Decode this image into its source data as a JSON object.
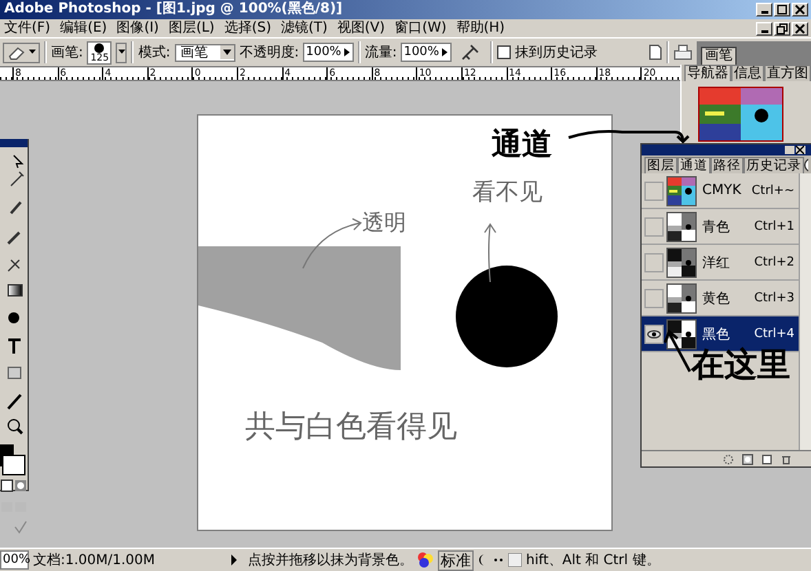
{
  "window": {
    "title": "Adobe Photoshop - [图1.jpg @ 100%(黑色/8)]"
  },
  "menu": [
    "文件(F)",
    "编辑(E)",
    "图像(I)",
    "图层(L)",
    "选择(S)",
    "滤镜(T)",
    "视图(V)",
    "窗口(W)",
    "帮助(H)"
  ],
  "options_bar": {
    "brush_label": "画笔:",
    "brush_size": "125",
    "mode_label": "模式:",
    "mode_value": "画笔",
    "opacity_label": "不透明度:",
    "opacity_value": "100%",
    "flow_label": "流量:",
    "flow_value": "100%",
    "erase_to_history": {
      "label": "抹到历史记录",
      "checked": false
    },
    "palette_well_tab": "画笔"
  },
  "ruler": [
    "8",
    "6",
    "4",
    "2",
    "0",
    "2",
    "4",
    "6",
    "8",
    "10",
    "12",
    "14",
    "16",
    "18",
    "20"
  ],
  "navigator": {
    "tabs": [
      {
        "label": "导航器",
        "selected": true
      },
      {
        "label": "信息",
        "selected": false
      },
      {
        "label": "直方图",
        "selected": false
      }
    ]
  },
  "channels_palette": {
    "tabs": [
      {
        "label": "图层",
        "selected": false
      },
      {
        "label": "通道",
        "selected": true
      },
      {
        "label": "路径",
        "selected": false
      },
      {
        "label": "历史记录",
        "selected": false
      }
    ],
    "rows": [
      {
        "name": "CMYK",
        "shortcut": "Ctrl+~",
        "kind": "composite",
        "visible": false,
        "selected": false
      },
      {
        "name": "青色",
        "shortcut": "Ctrl+1",
        "kind": "single",
        "visible": false,
        "selected": false
      },
      {
        "name": "洋红",
        "shortcut": "Ctrl+2",
        "kind": "single",
        "visible": false,
        "selected": false
      },
      {
        "name": "黄色",
        "shortcut": "Ctrl+3",
        "kind": "single",
        "visible": false,
        "selected": false
      },
      {
        "name": "黑色",
        "shortcut": "Ctrl+4",
        "kind": "single",
        "visible": true,
        "selected": true
      }
    ]
  },
  "annotations": [
    {
      "text": "通道",
      "kind": "bold"
    },
    {
      "text": "看不见",
      "kind": "thin"
    },
    {
      "text": "透明",
      "kind": "thin"
    },
    {
      "text": "共与白色看得见",
      "kind": "thin"
    },
    {
      "text": "在这里",
      "kind": "bold"
    }
  ],
  "status_bar": {
    "zoom": "00%",
    "doc_size": "文档:1.00M/1.00M",
    "hint": "点按并拖移以抹为背景色。",
    "mode": "标准",
    "hint_tail": "hift、Alt 和 Ctrl 键。"
  }
}
